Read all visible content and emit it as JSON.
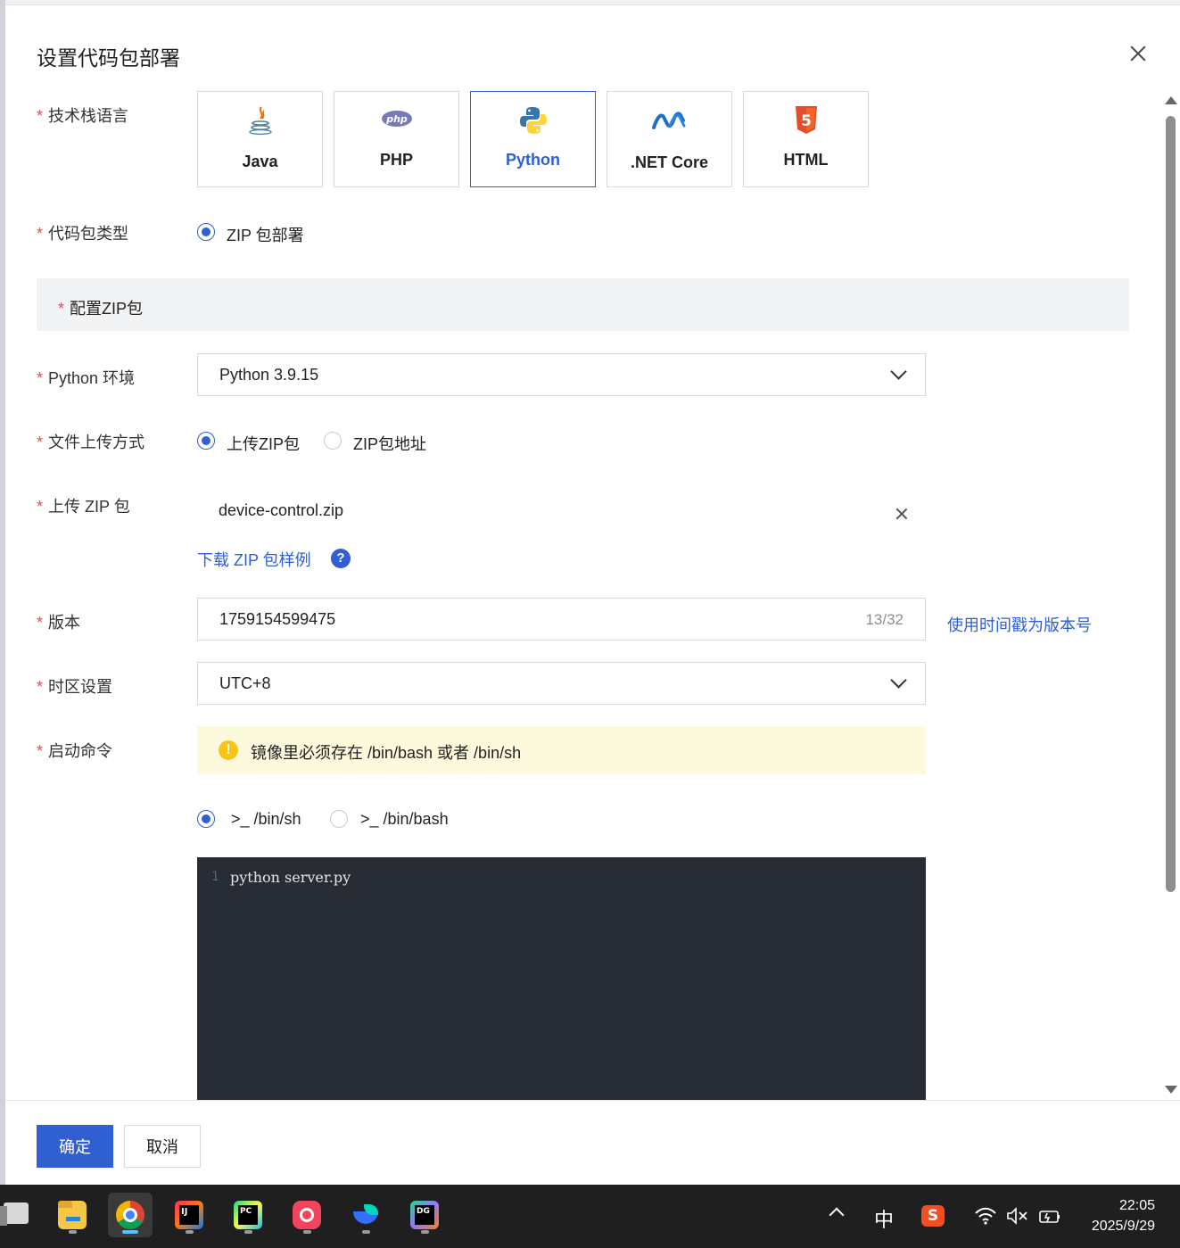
{
  "dialog": {
    "title": "设置代码包部署",
    "required_mark": "*"
  },
  "tech_stack": {
    "label": "技术栈语言",
    "options": [
      {
        "name": "Java",
        "icon": "java-icon",
        "selected": false
      },
      {
        "name": "PHP",
        "icon": "php-icon",
        "selected": false
      },
      {
        "name": "Python",
        "icon": "python-icon",
        "selected": true
      },
      {
        "name": ".NET Core",
        "icon": "dotnet-icon",
        "selected": false
      },
      {
        "name": "HTML",
        "icon": "html5-icon",
        "selected": false
      }
    ]
  },
  "package_type": {
    "label": "代码包类型",
    "option": "ZIP 包部署"
  },
  "zip_section": {
    "title": "配置ZIP包"
  },
  "python_env": {
    "label": "Python 环境",
    "value": "Python 3.9.15"
  },
  "upload_method": {
    "label": "文件上传方式",
    "options": [
      "上传ZIP包",
      "ZIP包地址"
    ],
    "selected": "上传ZIP包"
  },
  "upload_zip": {
    "label": "上传 ZIP 包",
    "file_name": "device-control.zip",
    "download_link": "下载 ZIP 包样例",
    "help_glyph": "?"
  },
  "version": {
    "label": "版本",
    "value": "1759154599475",
    "counter": "13/32",
    "timestamp_link": "使用时间戳为版本号"
  },
  "timezone": {
    "label": "时区设置",
    "value": "UTC+8"
  },
  "start_command": {
    "label": "启动命令",
    "warning": "镜像里必须存在 /bin/bash 或者 /bin/sh",
    "warning_glyph": "!",
    "shells": [
      ">_ /bin/sh",
      ">_ /bin/bash"
    ],
    "selected_shell": ">_ /bin/sh",
    "editor": {
      "line_number": "1",
      "code": "python server.py"
    }
  },
  "footer": {
    "confirm": "确定",
    "cancel": "取消"
  },
  "taskbar": {
    "apps": [
      "file-explorer-icon",
      "chrome-icon",
      "intellij-icon",
      "pycharm-icon",
      "app-red-icon",
      "feishu-icon",
      "datagrip-icon"
    ],
    "ime": "中",
    "time": "22:05",
    "date": "2025/9/29"
  },
  "colors": {
    "accent": "#2f5fd0",
    "required": "#e34d59",
    "warning_bg": "#fdf9dc",
    "editor_bg": "#282c34"
  }
}
